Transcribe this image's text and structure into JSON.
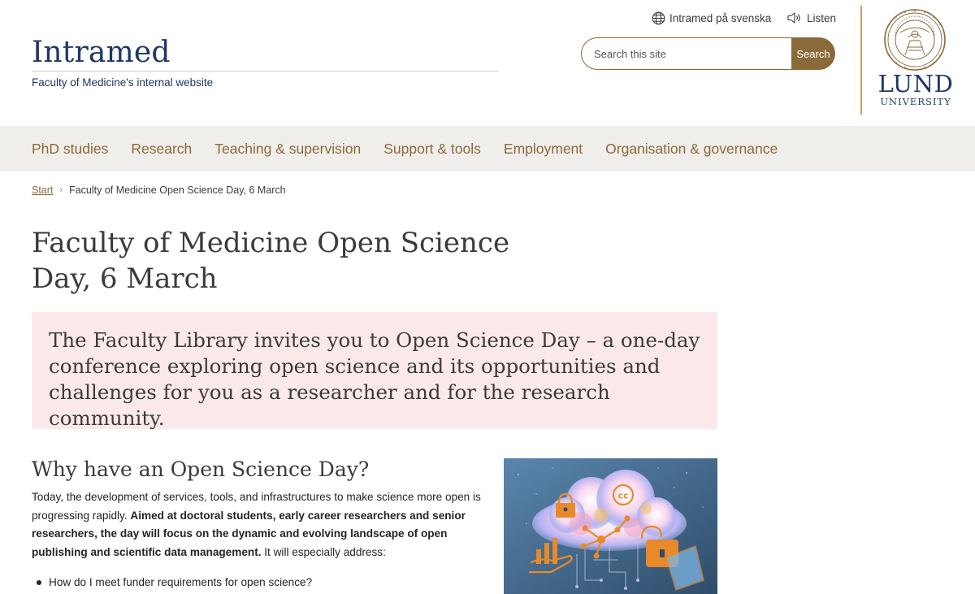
{
  "header": {
    "site_title": "Intramed",
    "site_subtitle": "Faculty of Medicine's internal website",
    "language_link": "Intramed på svenska",
    "listen_link": "Listen",
    "search_placeholder": "Search this site",
    "search_button": "Search",
    "logo": {
      "line1": "LUND",
      "line2": "UNIVERSITY"
    }
  },
  "nav": {
    "items": [
      "PhD studies",
      "Research",
      "Teaching & supervision",
      "Support & tools",
      "Employment",
      "Organisation & governance"
    ]
  },
  "breadcrumb": {
    "start": "Start",
    "separator": "›",
    "current": "Faculty of Medicine Open Science Day, 6 March"
  },
  "page": {
    "title": "Faculty of Medicine Open Science Day, 6 March",
    "intro": "The Faculty Library invites you to Open Science Day – a one-day conference exploring open science and its opportunities and challenges for you as a researcher and for the research community.",
    "section_heading": "Why have an Open Science Day?",
    "paragraph_start": "Today, the development of services, tools, and infrastructures to make science more open is progressing rapidly. ",
    "paragraph_bold": "Aimed at doctoral students, early career researchers and senior researchers, the day will focus on the dynamic and evolving landscape of open publishing and scientific data management.",
    "paragraph_end": " It will especially address:",
    "bullets": [
      "How do I meet funder requirements for open science?"
    ]
  },
  "colors": {
    "brand_blue": "#1e3765",
    "bronze": "#8b6a3a",
    "nav_bg": "#f0eeeb",
    "intro_bg": "#fbe9e9"
  }
}
